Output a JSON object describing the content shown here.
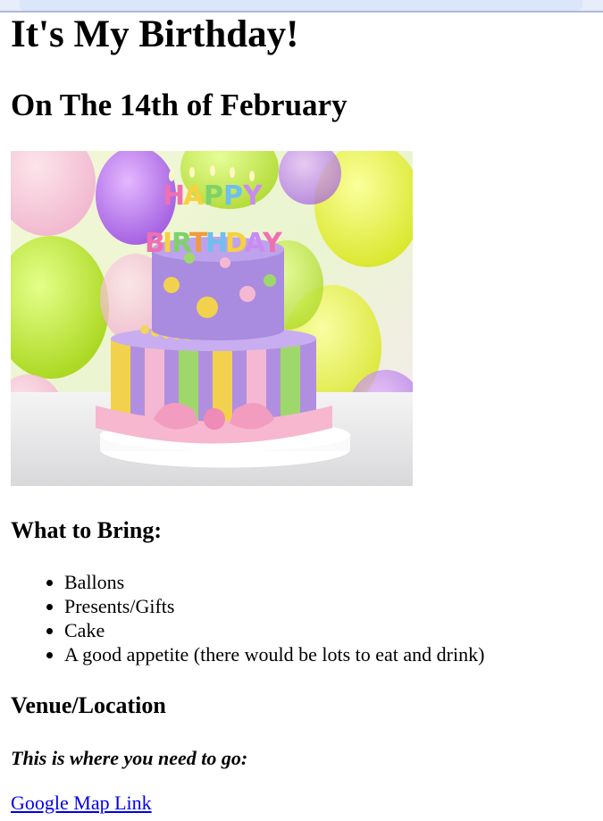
{
  "page": {
    "title": "It's My Birthday!",
    "date_heading": "On The 14th of February"
  },
  "image": {
    "icon": "birthday-cake-image",
    "candle_letters_top": "HAPPY",
    "candle_letters_bottom": "BIRTHDAY"
  },
  "bring": {
    "heading": "What to Bring:",
    "items": [
      "Ballons",
      "Presents/Gifts",
      "Cake",
      "A good appetite (there would be lots to eat and drink)"
    ]
  },
  "venue": {
    "heading": "Venue/Location",
    "note": "This is where you need to go:",
    "link_text": "Google Map Link"
  },
  "colors": {
    "link": "#0000ee",
    "text": "#000000"
  }
}
